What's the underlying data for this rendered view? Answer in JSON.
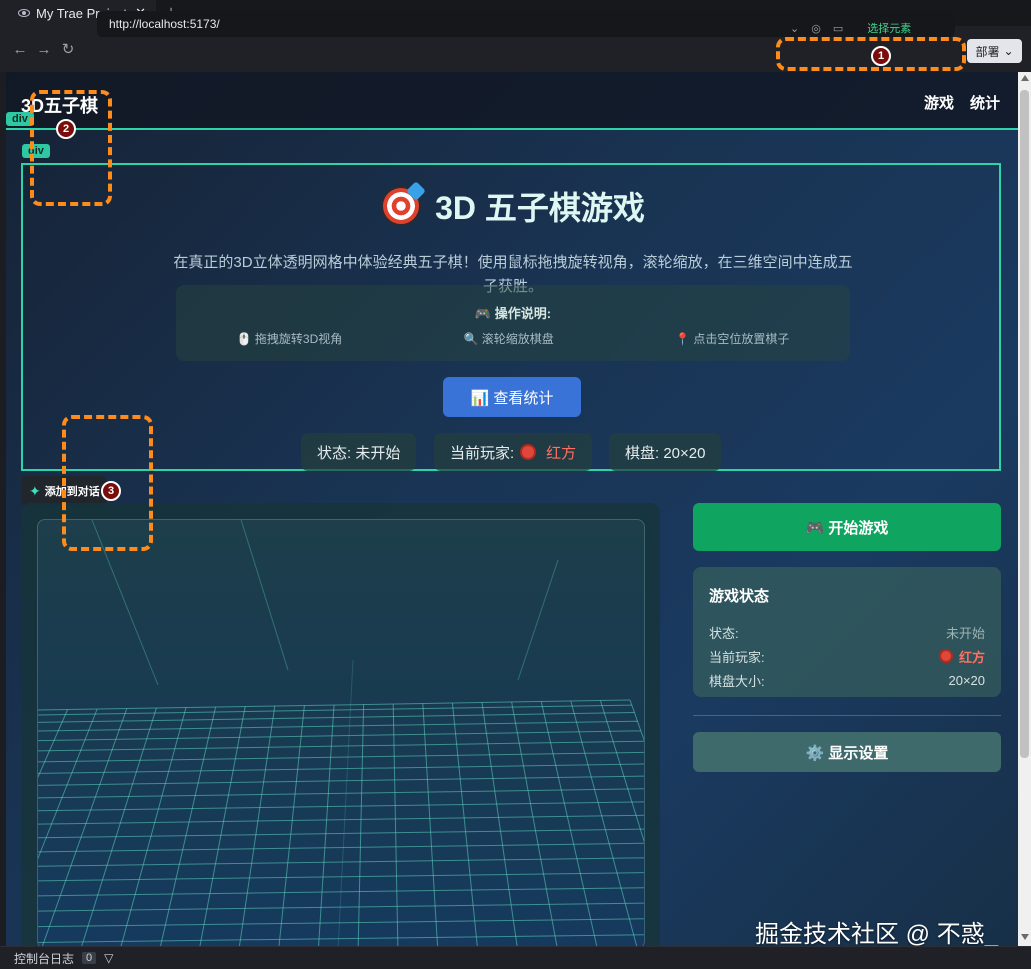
{
  "tab": {
    "title": "My Trae Project",
    "close": "✕",
    "new": "+"
  },
  "address": {
    "back": "←",
    "forward": "→",
    "reload": "↻",
    "url": "http://localhost:5173/",
    "select_element": "选择元素",
    "deploy": "部署",
    "dropdown": "⌄"
  },
  "callouts": [
    "1",
    "2",
    "3"
  ],
  "site": {
    "logo": "3D五子棋",
    "nav": [
      "游戏",
      "统计"
    ],
    "div_tag": "div"
  },
  "hero": {
    "title": "3D 五子棋游戏",
    "description": "在真正的3D立体透明网格中体验经典五子棋！使用鼠标拖拽旋转视角，滚轮缩放，在三维空间中连成五子获胜。",
    "guide_title": "🎮 操作说明:",
    "guide_items": [
      "🖱️ 拖拽旋转3D视角",
      "🔍 滚轮缩放棋盘",
      "📍 点击空位放置棋子"
    ],
    "stats_button": "📊 查看统计",
    "chips": {
      "status": "状态: 未开始",
      "player_label": "当前玩家:",
      "player_value": "红方",
      "board": "棋盘: 20×20"
    }
  },
  "add_dialog": "添加到对话",
  "sidebar": {
    "start_button": "🎮 开始游戏",
    "status_title": "游戏状态",
    "rows": [
      {
        "label": "状态:",
        "value": "未开始"
      },
      {
        "label": "当前玩家:",
        "value": "红方"
      },
      {
        "label": "棋盘大小:",
        "value": "20×20"
      }
    ],
    "settings_button": "⚙️ 显示设置"
  },
  "watermark": "掘金技术社区 @ 不惑_",
  "console": {
    "label": "控制台日志",
    "count": "0",
    "filter": "▽"
  },
  "colors": {
    "accent": "#2fd3a8",
    "start": "#0fa45f",
    "stats": "#3a73d8",
    "red_player": "#e0473a",
    "callout": "#ff8c1a"
  },
  "grid": {
    "board_size": 20
  }
}
